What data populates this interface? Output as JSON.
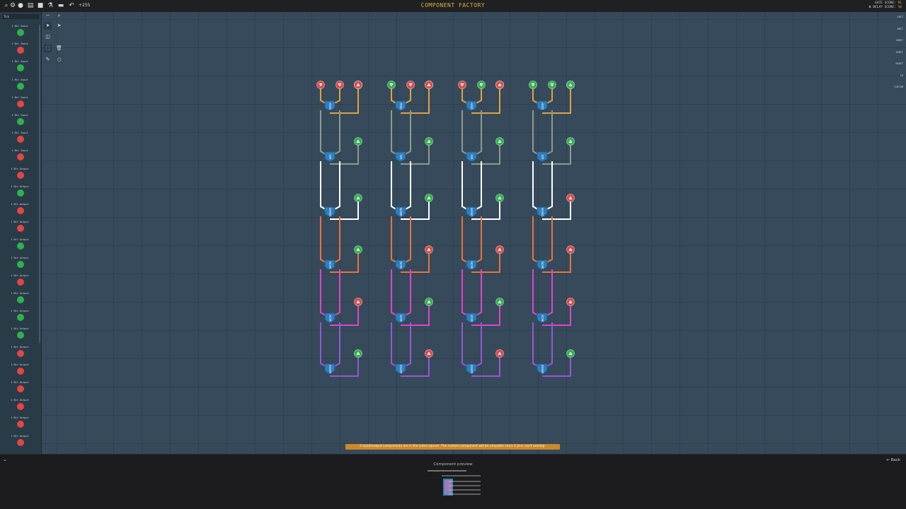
{
  "window": {
    "title": "COMPONENT FACTORY",
    "credits": "+255"
  },
  "scores": {
    "gate_label": "GATE SCORE:",
    "gate_value": "91",
    "delay_label": "DELAY SCORE:",
    "delay_value": "18"
  },
  "sidebar": {
    "tick_label": "Tick",
    "items": [
      {
        "label": "1 Bit Input",
        "color": "#2db34a"
      },
      {
        "label": "1 Bit Input",
        "color": "#e24646"
      },
      {
        "label": "1 Bit Input",
        "color": "#2db34a"
      },
      {
        "label": "1 Bit Input",
        "color": "#2db34a"
      },
      {
        "label": "1 Bit Input",
        "color": "#e24646"
      },
      {
        "label": "1 Bit Input",
        "color": "#2db34a"
      },
      {
        "label": "1 Bit Input",
        "color": "#e24646"
      },
      {
        "label": "1 Bit Input",
        "color": "#e24646"
      },
      {
        "label": "1 Bit Output",
        "color": "#e24646"
      },
      {
        "label": "1 Bit Output",
        "color": "#2db34a"
      },
      {
        "label": "1 Bit Output",
        "color": "#e24646"
      },
      {
        "label": "1 Bit Output",
        "color": "#e24646"
      },
      {
        "label": "1 Bit Output",
        "color": "#2db34a"
      },
      {
        "label": "1 Bit Output",
        "color": "#2db34a"
      },
      {
        "label": "1 Bit Output",
        "color": "#e24646"
      },
      {
        "label": "1 Bit Output",
        "color": "#2db34a"
      },
      {
        "label": "1 Bit Output",
        "color": "#2db34a"
      },
      {
        "label": "1 Bit Output",
        "color": "#2db34a"
      },
      {
        "label": "1 Bit Output",
        "color": "#e24646"
      },
      {
        "label": "1 Bit Output",
        "color": "#e24646"
      },
      {
        "label": "1 Bit Output",
        "color": "#e24646"
      },
      {
        "label": "1 Bit Output",
        "color": "#e24646"
      },
      {
        "label": "1 Bit Output",
        "color": "#e24646"
      },
      {
        "label": "1 Bit Output",
        "color": "#e24646"
      }
    ]
  },
  "rightbar": {
    "items": [
      "1BIT",
      "8BIT",
      "16BIT",
      "32BIT",
      "64BIT",
      "IO",
      "CUSTOM"
    ]
  },
  "warning": "2 input/output components are in the same square. The custom component will be unusable since 2 pins can't overlap.",
  "bottom": {
    "preview_title": "Component preview",
    "back_label": "Back"
  },
  "colors": {
    "red": "#e24646",
    "green": "#2db34a",
    "and_wire": "#e2a23c",
    "or_wire": "#8f9a8a",
    "nand_wire": "#ffffff",
    "nor_wire": "#e8743a",
    "xor_wire": "#e044c8",
    "xnor_wire": "#9a55d6",
    "gate": "#2f7fc0",
    "accent": "#e0b13c"
  },
  "circuit": {
    "columns": [
      {
        "inputs": [
          "red",
          "red",
          "red"
        ],
        "outputs": [
          "red",
          "green",
          "green",
          "green",
          "red",
          "green"
        ]
      },
      {
        "inputs": [
          "green",
          "red",
          "red"
        ],
        "outputs": [
          "red",
          "green",
          "green",
          "red",
          "green",
          "red"
        ]
      },
      {
        "inputs": [
          "red",
          "green",
          "red"
        ],
        "outputs": [
          "red",
          "green",
          "green",
          "red",
          "green",
          "red"
        ]
      },
      {
        "inputs": [
          "green",
          "green",
          "green"
        ],
        "outputs": [
          "green",
          "green",
          "red",
          "red",
          "red",
          "green"
        ]
      }
    ],
    "gates": [
      "AND",
      "OR",
      "NAND",
      "NOR",
      "XOR",
      "XNOR"
    ]
  }
}
